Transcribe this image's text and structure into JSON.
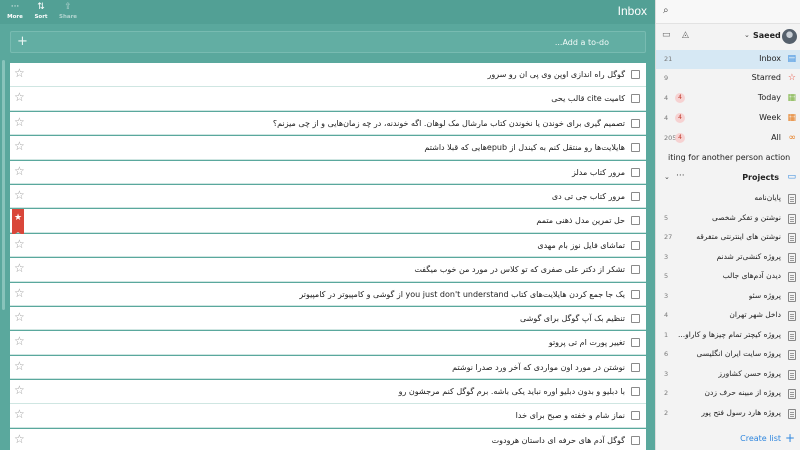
{
  "toolbar": {
    "more_label": "More",
    "sort_label": "Sort",
    "share_label": "Share",
    "list_title": "Inbox"
  },
  "add_todo": {
    "placeholder": "...Add a to-do",
    "plus_icon": "+"
  },
  "tasks": [
    {
      "text": "گوگل راه اندازی اوپن وی پی ان رو سرور",
      "starred": false
    },
    {
      "text": "کامیت cite قالب یحی",
      "starred": false
    },
    {
      "text": "تصمیم گیری برای خوندن یا نخوندن کتاب مارشال مک لوهان. اگه خوندنه، در چه زمان‌هایی و از چی میزنم؟",
      "starred": false
    },
    {
      "text": "هایلایت‌ها رو منتقل کنم به کیندل از epubهایی که قبلا داشتم",
      "starred": false
    },
    {
      "text": "مرور کتاب مدلز",
      "starred": false
    },
    {
      "text": "مرور کتاب جی تی دی",
      "starred": false
    },
    {
      "text": "حل تمرین مدل ذهنی متمم",
      "starred": true
    },
    {
      "text": "تماشای فایل نوز بام مهدی",
      "starred": false
    },
    {
      "text": "تشکر از دکتر علی صفری که تو کلاس در مورد من خوب میگفت",
      "starred": false
    },
    {
      "text": "یک جا جمع کردن هایلایت‌های کتاب you just don't understand از گوشی و کامپیوتر در کامپیوتر",
      "starred": false
    },
    {
      "text": "تنظیم بک آپ گوگل برای گوشی",
      "starred": false
    },
    {
      "text": "تغییر پورت ام تی پروتو",
      "starred": false
    },
    {
      "text": "نوشتن در مورد اون مواردی که آخر ورد صدرا نوشتم",
      "starred": false
    },
    {
      "text": "با دبلیو و بدون دبلیو اوره نباید یکی باشه. برم گوگل کنم مرجشون رو",
      "starred": false
    },
    {
      "text": "نماز شام و خفته و صبح برای خدا",
      "starred": false
    },
    {
      "text": "گوگل آدم های حرفه ای داستان هرودوت",
      "starred": false
    }
  ],
  "sidebar": {
    "user_name": "Saeed",
    "nav": [
      {
        "label": "Inbox",
        "count": "21",
        "badge": "",
        "icon": "inbox-icon",
        "color": "#2e86de"
      },
      {
        "label": "Starred",
        "count": "9",
        "badge": "",
        "icon": "star-icon",
        "color": "#e74c3c"
      },
      {
        "label": "Today",
        "count": "4",
        "badge": "4",
        "icon": "calendar-today-icon",
        "color": "#7cb342"
      },
      {
        "label": "Week",
        "count": "4",
        "badge": "4",
        "icon": "calendar-week-icon",
        "color": "#e67e22"
      },
      {
        "label": "All",
        "count": "205",
        "badge": "4",
        "icon": "infinity-icon",
        "color": "#e67e22"
      },
      {
        "label": "iting for another person action",
        "count": "",
        "badge": "",
        "icon": "",
        "color": ""
      }
    ],
    "projects_title": "Projects",
    "projects": [
      {
        "label": "پایان‌نامه",
        "count": ""
      },
      {
        "label": "نوشتن و تفکر شخصی",
        "count": "5"
      },
      {
        "label": "نوشتن های اینترنتی متفرقه",
        "count": "27"
      },
      {
        "label": "پروژه کنشی‌تر شدنم",
        "count": "3"
      },
      {
        "label": "دیدن آدم‌های جالب",
        "count": "5"
      },
      {
        "label": "پروژه سئو",
        "count": "3"
      },
      {
        "label": "داخل شهر تهران",
        "count": "4"
      },
      {
        "label": "پروژه کیچتر تمام چیزها و کاراو...",
        "count": "1"
      },
      {
        "label": "پروژه سایت ایران انگلیسی",
        "count": "6"
      },
      {
        "label": "پروژه حسن کشاورز",
        "count": "3"
      },
      {
        "label": "پروژه از مبینه حرف زدن",
        "count": "2"
      },
      {
        "label": "پروژه هارد رسول فتح پور",
        "count": "2"
      }
    ],
    "create_list_label": "Create list"
  }
}
